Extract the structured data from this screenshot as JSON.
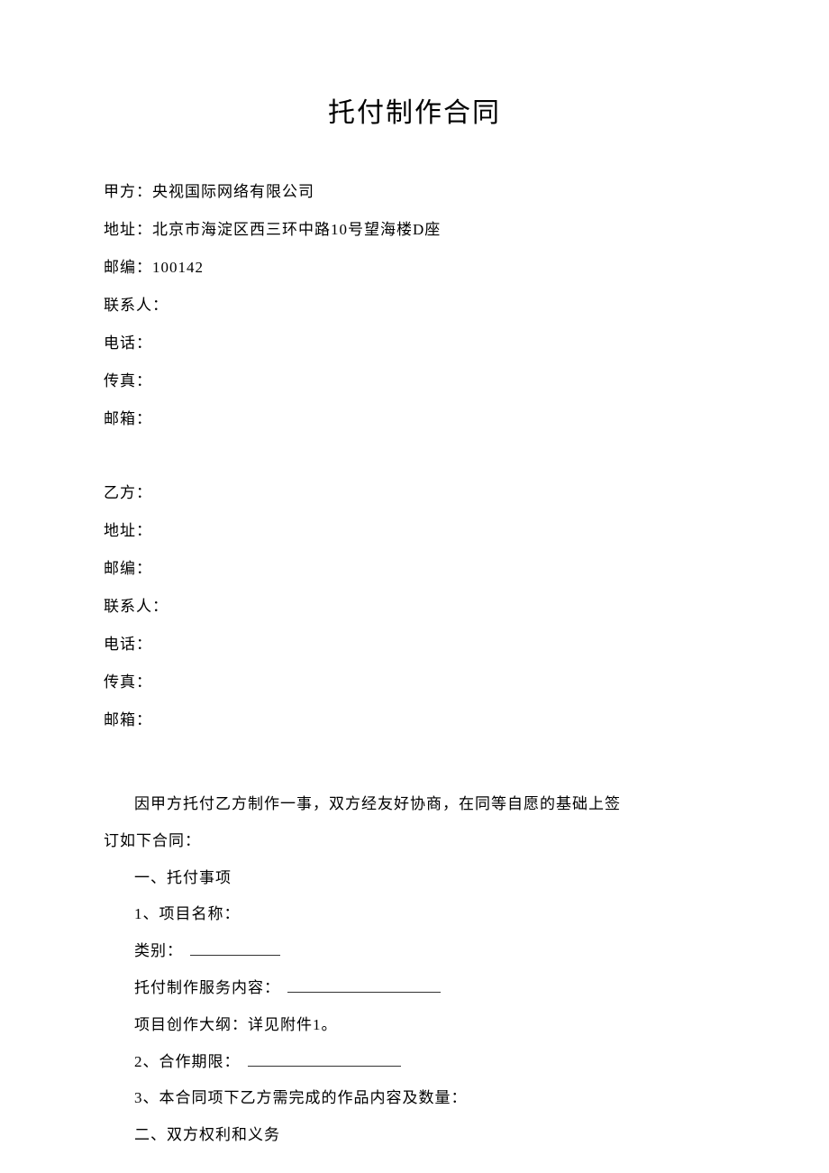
{
  "title": "托付制作合同",
  "partyA": {
    "nameLabel": "甲方：",
    "nameValue": "央视国际网络有限公司",
    "addressLabel": "地址：",
    "addressValue": "北京市海淀区西三环中路10号望海楼D座",
    "postcodeLabel": "邮编：",
    "postcodeValue": "100142",
    "contactLabel": "联系人：",
    "contactValue": "",
    "phoneLabel": "电话：",
    "phoneValue": "",
    "faxLabel": "传真：",
    "faxValue": "",
    "emailLabel": "邮箱：",
    "emailValue": ""
  },
  "partyB": {
    "nameLabel": "乙方：",
    "nameValue": "",
    "addressLabel": "地址：",
    "addressValue": "",
    "postcodeLabel": "邮编：",
    "postcodeValue": "",
    "contactLabel": "联系人：",
    "contactValue": "",
    "phoneLabel": "电话：",
    "phoneValue": "",
    "faxLabel": "传真：",
    "faxValue": "",
    "emailLabel": "邮箱：",
    "emailValue": ""
  },
  "body": {
    "preamble1": "因甲方托付乙方制作一事，双方经友好协商，在同等自愿的基础上签",
    "preamble2": "订如下合同：",
    "section1Title": "一、托付事项",
    "item1": "1、项目名称：",
    "item1Category": "类别：",
    "item1Service": "托付制作服务内容：",
    "item1Outline": "项目创作大纲：详见附件1。",
    "item2": "2、合作期限：",
    "item3": "3、本合同项下乙方需完成的作品内容及数量：",
    "section2Title": "二、双方权利和义务"
  }
}
